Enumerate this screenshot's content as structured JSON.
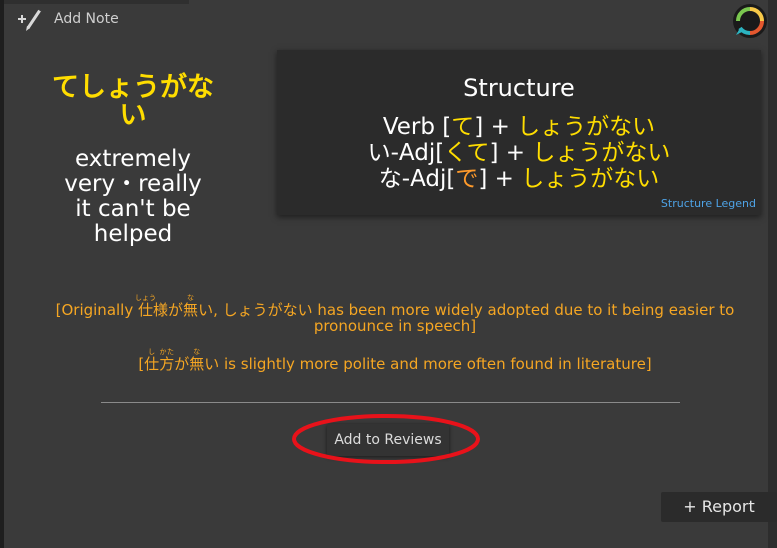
{
  "toolbar": {
    "add_note_label": "Add Note"
  },
  "vocab": {
    "word": "てしょうがない",
    "meanings": [
      "extremely",
      "very・really",
      "it can't be",
      "helped"
    ]
  },
  "structure": {
    "title": "Structure",
    "lines": [
      {
        "base": "Verb [",
        "particle": "て",
        "close": "] + ",
        "suffix": "しょうがない"
      },
      {
        "base": "い-Adj[",
        "particle": "くて",
        "close": "] + ",
        "suffix": "しょうがない"
      },
      {
        "base": "な-Adj[",
        "particle": "で",
        "close": "] + ",
        "suffix": "しょうがない"
      }
    ],
    "legend_link": "Structure Legend"
  },
  "notes": {
    "note1_before": "[Originally ",
    "note1_kanji1": "仕",
    "note1_furi1": "しょう",
    "note1_kanji2": "様",
    "note1_kana1": "が",
    "note1_kanji3": "無",
    "note1_furi3": "な",
    "note1_after": "い, しょうがない has been more widely adopted due to it being easier to pronounce in speech]",
    "note2_before": "[",
    "note2_kanji1": "仕",
    "note2_furi1": "し",
    "note2_kanji2": "方",
    "note2_furi2": "かた",
    "note2_kana1": "が",
    "note2_kanji3": "無",
    "note2_furi3": "な",
    "note2_after": "い is slightly more polite and more often found in literature]"
  },
  "actions": {
    "add_to_reviews": "Add to Reviews",
    "report": "+ Report"
  },
  "colors": {
    "background": "#3a3a3a",
    "panel": "#2b2b2b",
    "word_yellow": "#ffdd00",
    "particle_orange": "#ff9a2a",
    "note_orange": "#f5a623",
    "link_blue": "#4ea3e6",
    "highlight_red": "#e8121a"
  },
  "icons": {
    "add_note": "pencil-plus-icon",
    "logo": "chat-bubble-logo"
  }
}
